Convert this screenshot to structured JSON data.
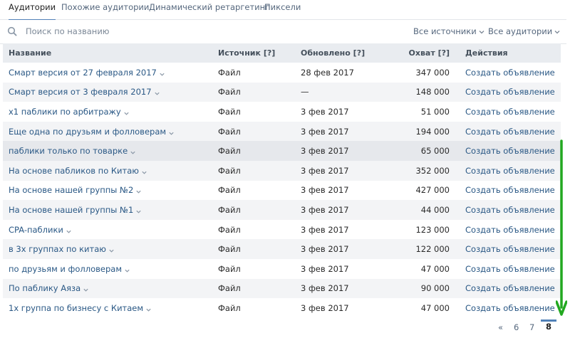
{
  "tabs": [
    {
      "label": "Аудитории",
      "active": true
    },
    {
      "label": "Похожие аудитории",
      "active": false
    },
    {
      "label": "Динамический ретаргетинг",
      "active": false
    },
    {
      "label": "Пиксели",
      "active": false
    }
  ],
  "search": {
    "placeholder": "Поиск по названию",
    "value": ""
  },
  "filters": {
    "sources": "Все источники",
    "audiences": "Все аудитории"
  },
  "table": {
    "headers": {
      "name": "Название",
      "source": "Источник",
      "updated": "Обновлено",
      "reach": "Охват",
      "actions": "Действия",
      "help_mark": "[?]"
    },
    "rows": [
      {
        "name": "Смарт версия от 27 февраля 2017",
        "source": "Файл",
        "updated": "28 фев 2017",
        "reach": "347 000",
        "action": "Создать объявление"
      },
      {
        "name": "Смарт версия от 3 февраля 2017",
        "source": "Файл",
        "updated": "—",
        "reach": "148 000",
        "action": "Создать объявление"
      },
      {
        "name": "х1 паблики по арбитражу",
        "source": "Файл",
        "updated": "3 фев 2017",
        "reach": "51 000",
        "action": "Создать объявление"
      },
      {
        "name": "Еще одна по друзьям и фолловерам",
        "source": "Файл",
        "updated": "3 фев 2017",
        "reach": "194 000",
        "action": "Создать объявление"
      },
      {
        "name": "паблики только по товарке",
        "source": "Файл",
        "updated": "3 фев 2017",
        "reach": "65 000",
        "action": "Создать объявление"
      },
      {
        "name": "На основе пабликов по Китаю",
        "source": "Файл",
        "updated": "3 фев 2017",
        "reach": "352 000",
        "action": "Создать объявление"
      },
      {
        "name": "На основе нашей группы №2",
        "source": "Файл",
        "updated": "3 фев 2017",
        "reach": "427 000",
        "action": "Создать объявление"
      },
      {
        "name": "На основе нашей группы №1",
        "source": "Файл",
        "updated": "3 фев 2017",
        "reach": "44 000",
        "action": "Создать объявление"
      },
      {
        "name": "CPA-паблики",
        "source": "Файл",
        "updated": "3 фев 2017",
        "reach": "123 000",
        "action": "Создать объявление"
      },
      {
        "name": "в 3х группах по китаю",
        "source": "Файл",
        "updated": "3 фев 2017",
        "reach": "122 000",
        "action": "Создать объявление"
      },
      {
        "name": "по друзьям и фолловерам",
        "source": "Файл",
        "updated": "3 фев 2017",
        "reach": "47 000",
        "action": "Создать объявление"
      },
      {
        "name": "По паблику Аяза",
        "source": "Файл",
        "updated": "3 фев 2017",
        "reach": "90 000",
        "action": "Создать объявление"
      },
      {
        "name": "1х группа по бизнесу с Китаем",
        "source": "Файл",
        "updated": "3 фев 2017",
        "reach": "47 000",
        "action": "Создать объявление"
      }
    ],
    "hovered_row": 5
  },
  "pagination": {
    "prev": "«",
    "pages": [
      "6",
      "7",
      "8"
    ],
    "current": "8"
  },
  "colors": {
    "accent": "#5181b8",
    "link": "#2a5885",
    "header_bg": "#e9ecf0",
    "annotation_arrow": "#22a820"
  },
  "icons": {
    "search": "search-icon",
    "chevron": "chevron-down-icon",
    "annotation": "green-down-arrow-icon"
  }
}
